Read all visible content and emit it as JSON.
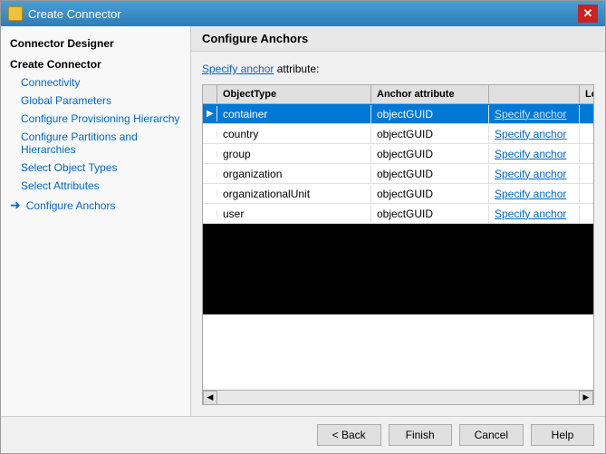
{
  "window": {
    "title": "Create Connector",
    "icon_label": "window-icon"
  },
  "sidebar": {
    "header": "Connector Designer",
    "items": [
      {
        "id": "create-connector",
        "label": "Create Connector",
        "indent": false,
        "arrow": false
      },
      {
        "id": "connectivity",
        "label": "Connectivity",
        "indent": true,
        "arrow": false
      },
      {
        "id": "global-parameters",
        "label": "Global Parameters",
        "indent": true,
        "arrow": false
      },
      {
        "id": "configure-provisioning-hierarchy",
        "label": "Configure Provisioning Hierarchy",
        "indent": true,
        "arrow": false
      },
      {
        "id": "configure-partitions-and-hierarchies",
        "label": "Configure Partitions and Hierarchies",
        "indent": true,
        "arrow": false
      },
      {
        "id": "select-object-types",
        "label": "Select Object Types",
        "indent": true,
        "arrow": false
      },
      {
        "id": "select-attributes",
        "label": "Select Attributes",
        "indent": true,
        "arrow": false
      },
      {
        "id": "configure-anchors",
        "label": "Configure Anchors",
        "indent": true,
        "arrow": true,
        "active": true
      }
    ]
  },
  "panel": {
    "header": "Configure Anchors",
    "specify_anchor_label": "Specify anchor",
    "specify_anchor_suffix": " attribute:",
    "table": {
      "columns": [
        {
          "id": "arrow-col",
          "label": ""
        },
        {
          "id": "object-type-col",
          "label": "ObjectType"
        },
        {
          "id": "anchor-attribute-col",
          "label": "Anchor attribute"
        },
        {
          "id": "specify-anchor-col",
          "label": ""
        },
        {
          "id": "locked-col",
          "label": "Locked"
        }
      ],
      "rows": [
        {
          "selected": true,
          "arrow": "▶",
          "objectType": "container",
          "anchorAttribute": "objectGUID",
          "specifyAnchor": "Specify anchor",
          "locked": true
        },
        {
          "selected": false,
          "arrow": "",
          "objectType": "country",
          "anchorAttribute": "objectGUID",
          "specifyAnchor": "Specify anchor",
          "locked": true
        },
        {
          "selected": false,
          "arrow": "",
          "objectType": "group",
          "anchorAttribute": "objectGUID",
          "specifyAnchor": "Specify anchor",
          "locked": true
        },
        {
          "selected": false,
          "arrow": "",
          "objectType": "organization",
          "anchorAttribute": "objectGUID",
          "specifyAnchor": "Specify anchor",
          "locked": true
        },
        {
          "selected": false,
          "arrow": "",
          "objectType": "organizationalUnit",
          "anchorAttribute": "objectGUID",
          "specifyAnchor": "Specify anchor",
          "locked": true
        },
        {
          "selected": false,
          "arrow": "",
          "objectType": "user",
          "anchorAttribute": "objectGUID",
          "specifyAnchor": "Specify anchor",
          "locked": true
        }
      ]
    }
  },
  "footer": {
    "back_label": "Back",
    "finish_label": "Finish",
    "cancel_label": "Cancel",
    "help_label": "Help"
  }
}
